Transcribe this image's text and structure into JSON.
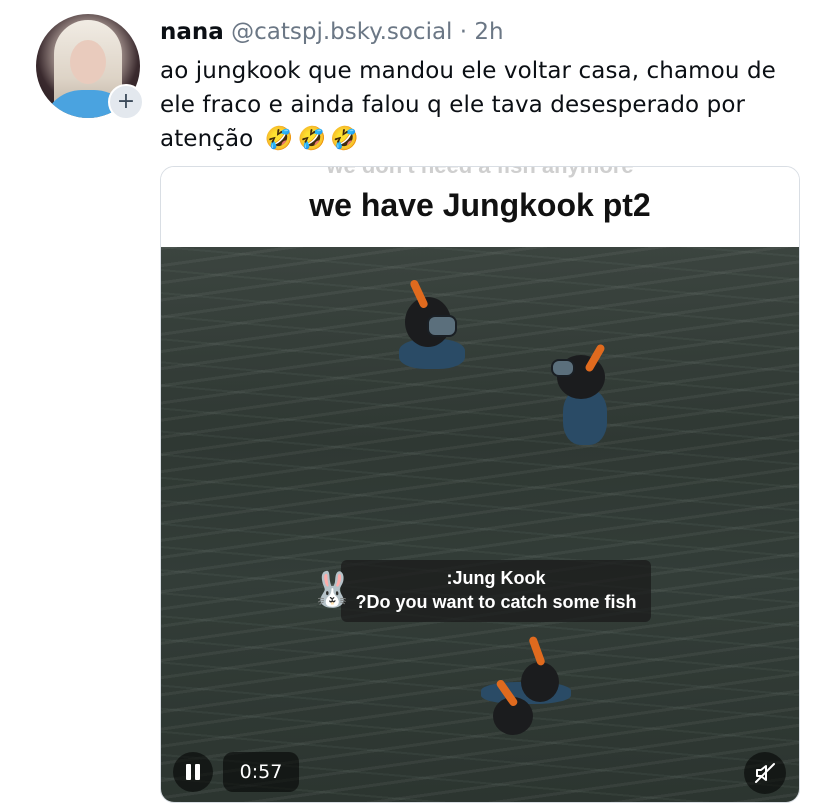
{
  "post": {
    "display_name": "nana",
    "handle": "@catspj.bsky.social",
    "separator": "·",
    "time": "2h",
    "text": "ao jungkook que mandou ele voltar casa, chamou de ele fraco e ainda falou q ele tava desesperado por atenção",
    "emojis": [
      "🤣",
      "🤣",
      "🤣"
    ]
  },
  "avatar": {
    "follow_symbol": "+"
  },
  "video": {
    "partial_top_text": "we don't need a fish anymore",
    "title": "we have Jungkook pt2",
    "caption_line1": ":Jung Kook",
    "caption_line2": "?Do you want to catch some fish",
    "caption_emoji": "🐰",
    "elapsed": "0:57",
    "state": "playing",
    "muted": true
  },
  "colors": {
    "accent_text": "#0b0f14",
    "muted_text": "#6b7785",
    "water": "#2f3833",
    "snorkel": "#e06a1e"
  }
}
